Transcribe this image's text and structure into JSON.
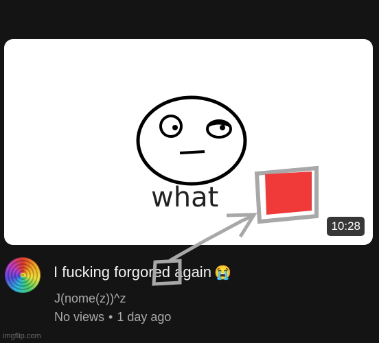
{
  "video": {
    "duration": "10:28",
    "thumbnail_text": "what",
    "title": "I fucking forgored again",
    "title_emoji": "😭",
    "channel": "J(nome(z))^z",
    "views": "No views",
    "separator": "•",
    "age": "1 day ago"
  },
  "watermark": "imgflip.com",
  "colors": {
    "background": "#141414",
    "thumb_square": "#f03a3a",
    "annotation": "#a8a8a8"
  }
}
